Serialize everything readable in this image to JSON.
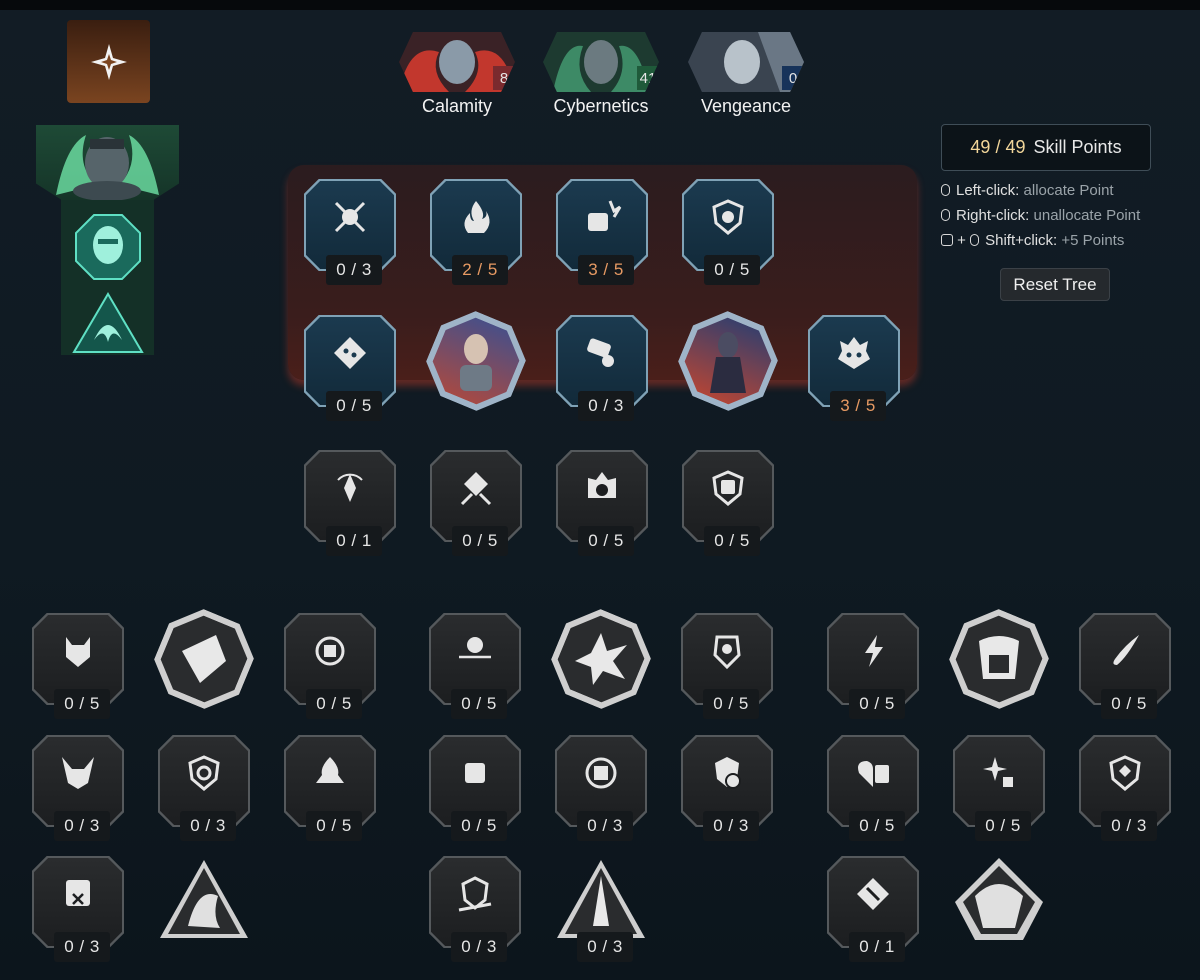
{
  "heroes": [
    {
      "name": "Calamity",
      "points": "8",
      "count_color": "#7a2a2e",
      "portrait_color": "#c2372d"
    },
    {
      "name": "Cybernetics",
      "points": "41",
      "count_color": "#1f5a3a",
      "portrait_color": "#3d8a66"
    },
    {
      "name": "Vengeance",
      "points": "0",
      "count_color": "#17335a",
      "portrait_color": "#8a9aa8"
    }
  ],
  "skill_points": {
    "current": "49",
    "separator": "/",
    "max": "49",
    "label": "Skill Points"
  },
  "hints": {
    "left_key": "Left-click:",
    "left_action": "allocate Point",
    "right_key": "Right-click:",
    "right_action": "unallocate Point",
    "shift_plus": "+",
    "shift_key": "Shift+click:",
    "shift_action": "+5 Points"
  },
  "reset_label": "Reset Tree",
  "colors": {
    "accent_orange": "#e79a63",
    "band_red": "#4a1f1a",
    "sp_gold": "#f2d69a"
  },
  "upper_nodes": [
    {
      "value": "0 / 3",
      "icon": "emblem-crossed-spears-icon"
    },
    {
      "value": "2 / 5",
      "icon": "flame-icon"
    },
    {
      "value": "3 / 5",
      "icon": "fist-impact-icon"
    },
    {
      "value": "0 / 5",
      "icon": "shield-icon"
    },
    {
      "value": "0 / 5",
      "icon": "dice-diamond-icon"
    },
    {
      "value": "0 / 3",
      "icon": "gadget-icon"
    },
    {
      "value": "3 / 5",
      "icon": "mask-flame-icon"
    },
    {
      "value": "0 / 1",
      "icon": "target-cycle-icon"
    },
    {
      "value": "0 / 5",
      "icon": "dice-crossed-swords-icon"
    },
    {
      "value": "0 / 5",
      "icon": "eye-flame-icon"
    },
    {
      "value": "0 / 5",
      "icon": "fist-shield-icon"
    }
  ],
  "lower_nodes": [
    {
      "value": "0 / 5",
      "icon": "demon-mask-icon"
    },
    {
      "value": "0 / 5",
      "icon": "cycle-fist-icon"
    },
    {
      "value": "0 / 5",
      "icon": "skull-arrows-icon"
    },
    {
      "value": "0 / 5",
      "icon": "mask-shield-icon"
    },
    {
      "value": "0 / 5",
      "icon": "lightning-icon"
    },
    {
      "value": "0 / 5",
      "icon": "comet-icon"
    },
    {
      "value": "0 / 3",
      "icon": "horned-mask-icon"
    },
    {
      "value": "0 / 3",
      "icon": "gear-shield-icon"
    },
    {
      "value": "0 / 5",
      "icon": "flame-dice-icon"
    },
    {
      "value": "0 / 5",
      "icon": "fist-burst-icon"
    },
    {
      "value": "0 / 3",
      "icon": "fist-cycle-icon"
    },
    {
      "value": "0 / 3",
      "icon": "shield-skull-icon"
    },
    {
      "value": "0 / 5",
      "icon": "heart-fist-icon"
    },
    {
      "value": "0 / 5",
      "icon": "sparkle-dice-icon"
    },
    {
      "value": "0 / 3",
      "icon": "shield-dice-icon"
    },
    {
      "value": "0 / 3",
      "icon": "fist-cross-icon"
    },
    {
      "value": "0 / 3",
      "icon": "shield-crossed-icon"
    },
    {
      "value": "0 / 3",
      "icon": "burst-icon"
    },
    {
      "value": "0 / 1",
      "icon": "dice-plus-icon"
    }
  ]
}
